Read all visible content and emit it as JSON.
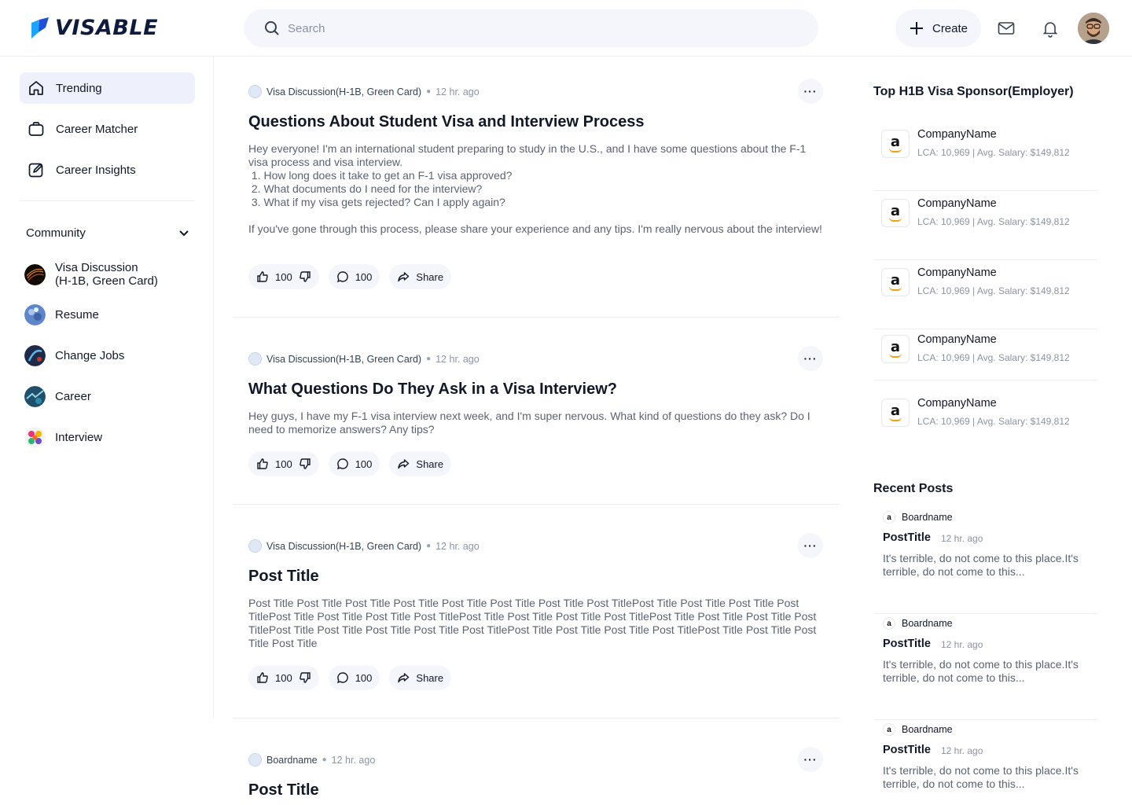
{
  "header": {
    "logo_text": "VISABLE",
    "search_placeholder": "Search",
    "create_label": "Create"
  },
  "sidebar": {
    "nav": [
      {
        "label": "Trending",
        "icon": "home-icon",
        "active": true
      },
      {
        "label": "Career Matcher",
        "icon": "bag-icon",
        "active": false
      },
      {
        "label": "Career Insights",
        "icon": "edit-icon",
        "active": false
      }
    ],
    "community_label": "Community",
    "communities": [
      {
        "label_line1": "Visa Discussion",
        "label_line2": "(H-1B, Green Card)"
      },
      {
        "label_line1": "Resume",
        "label_line2": ""
      },
      {
        "label_line1": "Change Jobs",
        "label_line2": ""
      },
      {
        "label_line1": "Career",
        "label_line2": ""
      },
      {
        "label_line1": "Interview",
        "label_line2": ""
      }
    ]
  },
  "feed": {
    "posts": [
      {
        "board": "Visa Discussion(H-1B, Green Card)",
        "time": "12 hr. ago",
        "title": "Questions About Student Visa and Interview Process",
        "body": "Hey everyone! I'm an international student preparing to study in the U.S., and I have some questions about the F-1 visa process and visa interview.\n 1. How long does it take to get an F-1 visa approved?\n 2. What documents do I need for the interview?\n 3. What if my visa gets rejected? Can I apply again?\n\nIf you've gone through this process, please share your experience and any tips. I'm really nervous about the interview!",
        "likes": "100",
        "comments": "100",
        "share_label": "Share"
      },
      {
        "board": "Visa Discussion(H-1B, Green Card)",
        "time": "12 hr. ago",
        "title": "What Questions Do They Ask in a Visa Interview?",
        "body": "Hey guys, I have my F-1 visa interview next week, and I'm super nervous. What kind of questions do they ask? Do I need to memorize answers? Any tips?",
        "likes": "100",
        "comments": "100",
        "share_label": "Share"
      },
      {
        "board": "Visa Discussion(H-1B, Green Card)",
        "time": "12 hr. ago",
        "title": "Post Title",
        "body": "Post Title Post Title Post Title Post Title Post Title Post Title Post Title Post TitlePost Title Post Title Post Title Post TitlePost Title Post Title Post Title Post TitlePost Title Post Title Post Title Post TitlePost Title Post Title Post Title Post TitlePost Title Post Title Post Title Post Title Post TitlePost Title Post Title Post Title Post TitlePost Title Post Title Post Title Post Title",
        "likes": "100",
        "comments": "100",
        "share_label": "Share"
      },
      {
        "board": "Boardname",
        "time": "12 hr. ago",
        "title": "Post Title"
      }
    ]
  },
  "right": {
    "sponsors_title": "Top H1B Visa Sponsor(Employer)",
    "sponsors": [
      {
        "name": "CompanyName",
        "stats": "LCA:  10,969 | Avg. Salary: $149,812"
      },
      {
        "name": "CompanyName",
        "stats": "LCA:  10,969 | Avg. Salary: $149,812"
      },
      {
        "name": "CompanyName",
        "stats": "LCA:  10,969 | Avg. Salary: $149,812"
      },
      {
        "name": "CompanyName",
        "stats": "LCA:  10,969 | Avg. Salary: $149,812"
      },
      {
        "name": "CompanyName",
        "stats": "LCA:  10,969 | Avg. Salary: $149,812"
      }
    ],
    "recent_title": "Recent Posts",
    "recent": [
      {
        "board": "Boardname",
        "title": "PostTitle",
        "time": "12 hr. ago",
        "body": "It's terrible, do not come to this place.It's terrible, do not come to this..."
      },
      {
        "board": "Boardname",
        "title": "PostTitle",
        "time": "12 hr. ago",
        "body": "It's terrible, do not come to this place.It's terrible, do not come to this..."
      },
      {
        "board": "Boardname",
        "title": "PostTitle",
        "time": "12 hr. ago",
        "body": "It's terrible, do not come to this place.It's terrible, do not come to this..."
      }
    ]
  },
  "colors": {
    "accent": "#eef0fb",
    "logo_blue": "#1f6feb",
    "text_primary": "#111827",
    "text_muted": "#8c93a3"
  }
}
